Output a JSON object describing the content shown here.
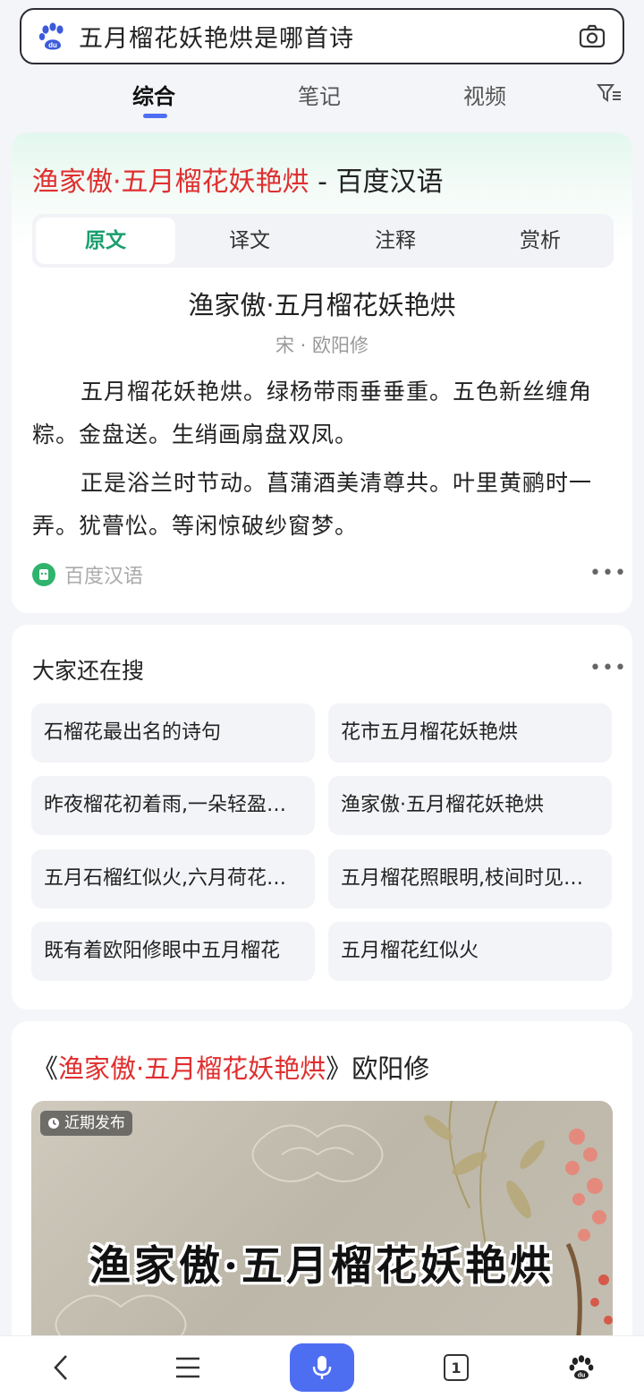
{
  "search": {
    "query": "五月榴花妖艳烘是哪首诗"
  },
  "tabs": [
    {
      "label": "综合",
      "active": true
    },
    {
      "label": "笔记",
      "active": false
    },
    {
      "label": "视频",
      "active": false
    }
  ],
  "card1": {
    "title_highlight": "渔家傲·五月榴花妖艳烘",
    "title_suffix": " - 百度汉语",
    "segments": [
      "原文",
      "译文",
      "注释",
      "赏析"
    ],
    "poem_title": "渔家傲·五月榴花妖艳烘",
    "poem_author": "宋 · 欧阳修",
    "paragraph1": "五月榴花妖艳烘。绿杨带雨垂垂重。五色新丝缠角粽。金盘送。生绡画扇盘双凤。",
    "paragraph2": "正是浴兰时节动。菖蒲酒美清尊共。叶里黄鹂时一弄。犹瞢忪。等闲惊破纱窗梦。",
    "source": "百度汉语",
    "more": "•••"
  },
  "card2": {
    "title": "大家还在搜",
    "more": "•••",
    "chips": [
      "石榴花最出名的诗句",
      "花市五月榴花妖艳烘",
      "昨夜榴花初着雨,一朵轻盈…",
      "渔家傲·五月榴花妖艳烘",
      "五月石榴红似火,六月荷花…",
      "五月榴花照眼明,枝间时见…",
      "既有着欧阳修眼中五月榴花",
      "五月榴花红似火"
    ]
  },
  "card3": {
    "title_open": "《",
    "title_highlight": "渔家傲·五月榴花妖艳烘",
    "title_close": "》欧阳修",
    "badge": "近期发布",
    "video_text": "渔家傲·五月榴花妖艳烘"
  },
  "bottom_nav": {
    "tab_count": "1"
  },
  "colors": {
    "accent": "#4e6ef2",
    "highlight_red": "#e02f2f",
    "green": "#1a9e6e"
  }
}
